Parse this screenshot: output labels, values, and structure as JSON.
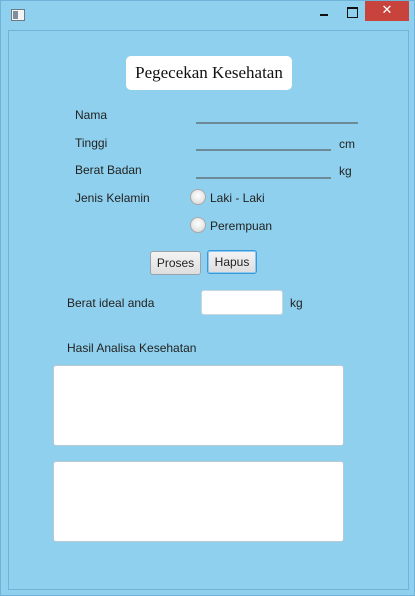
{
  "window": {
    "icons": {
      "app": "app-icon",
      "minimize": "minimize-icon",
      "maximize": "maximize-icon",
      "close": "close-icon"
    },
    "close_glyph": "✕",
    "accent_close": "#c8433c",
    "background": "#8fd0ee"
  },
  "header": {
    "title": "Pegecekan Kesehatan"
  },
  "form": {
    "nama_label": "Nama",
    "nama_value": "",
    "tinggi_label": "Tinggi",
    "tinggi_value": "",
    "tinggi_unit": "cm",
    "berat_label": "Berat Badan",
    "berat_value": "",
    "berat_unit": "kg",
    "gender_label": "Jenis Kelamin",
    "gender_options": [
      "Laki - Laki",
      "Perempuan"
    ],
    "gender_selected": null
  },
  "actions": {
    "proses": "Proses",
    "hapus": "Hapus"
  },
  "result": {
    "ideal_label": "Berat ideal anda",
    "ideal_value": "",
    "ideal_unit": "kg",
    "analysis_label": "Hasil Analisa Kesehatan",
    "analysis_text_1": "",
    "analysis_text_2": ""
  }
}
